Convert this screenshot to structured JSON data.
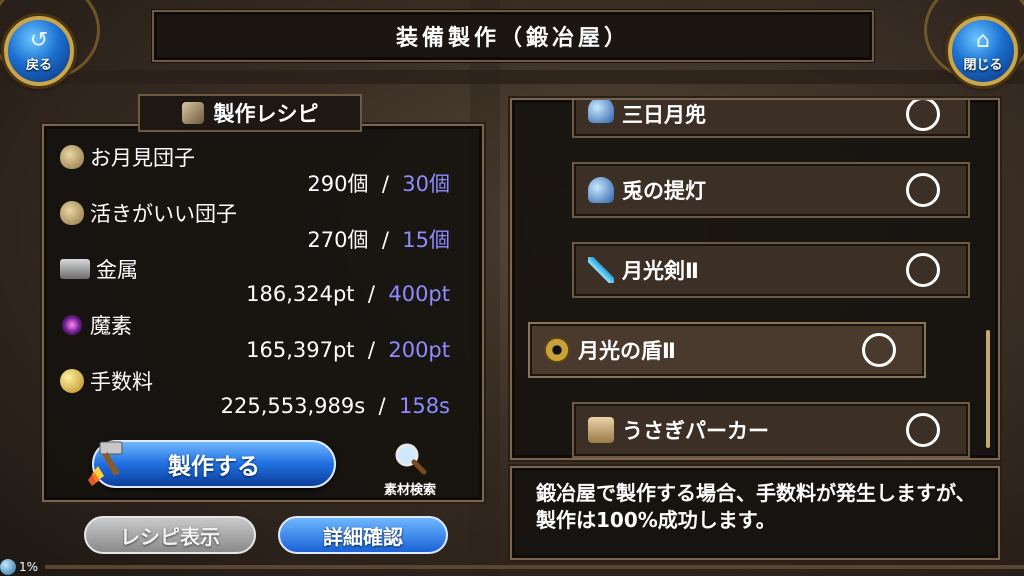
{
  "header": {
    "title": "装備製作（鍛冶屋）",
    "back_label": "戻る",
    "close_label": "閉じる"
  },
  "recipe": {
    "header_label": "製作レシピ",
    "materials": [
      {
        "name": "お月見団子",
        "have": "290個",
        "sep": "/",
        "need": "30個",
        "icon": "dango-bag-icon"
      },
      {
        "name": "活きがいい団子",
        "have": "270個",
        "sep": "/",
        "need": "15個",
        "icon": "dango-bag-icon"
      },
      {
        "name": "金属",
        "have": "186,324pt",
        "sep": "/",
        "need": "400pt",
        "icon": "metal-ingot-icon"
      },
      {
        "name": "魔素",
        "have": "165,397pt",
        "sep": "/",
        "need": "200pt",
        "icon": "magic-orb-icon"
      },
      {
        "name": "手数料",
        "have": "225,553,989s",
        "sep": "/",
        "need": "158s",
        "icon": "coin-icon"
      }
    ],
    "craft_button": "製作する",
    "search_button": "素材検索",
    "recipe_view_button": "レシピ表示",
    "detail_button": "詳細確認"
  },
  "item_list": [
    {
      "name": "三日月兜",
      "icon": "helmet-icon",
      "selected": false
    },
    {
      "name": "兎の提灯",
      "icon": "helmet-icon",
      "selected": false
    },
    {
      "name": "月光剣Ⅱ",
      "icon": "sword-icon",
      "selected": false
    },
    {
      "name": "月光の盾Ⅱ",
      "icon": "shield-icon",
      "selected": true
    },
    {
      "name": "うさぎパーカー",
      "icon": "clothing-icon",
      "selected": false
    }
  ],
  "message": "鍛冶屋で製作する場合、手数料が発生しますが、製作は100%成功します。",
  "status": {
    "progress_text": "1%"
  },
  "colors": {
    "required_amount": "#8f8cff",
    "button_blue": "#1f6fe0",
    "frame_gold": "#c9a64a"
  }
}
